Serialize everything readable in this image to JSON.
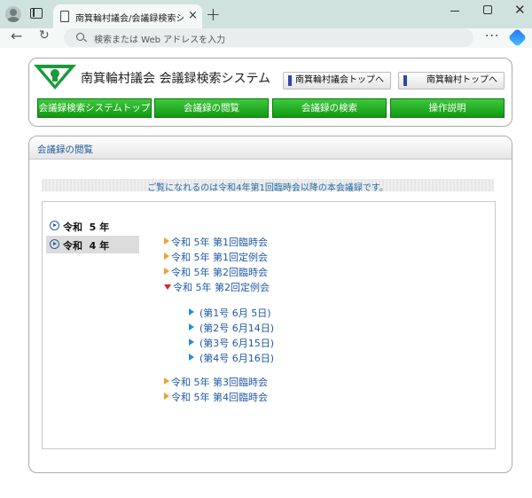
{
  "browser": {
    "tab_title": "南箕輪村議会/会議録検索システム",
    "tab_close": "×",
    "new_tab": "+",
    "url_placeholder": "検索または Web アドレスを入力",
    "back": "←",
    "refresh": "↻",
    "more": "···",
    "close": "✕"
  },
  "header": {
    "site_title": "南箕輪村議会 会議録検索システム",
    "links": [
      "南箕輪村議会トップへ",
      "南箕輪村トップへ"
    ],
    "nav": [
      "会議録検索システムトップ",
      "会議録の閲覧",
      "会議録の検索",
      "操作説明"
    ]
  },
  "main": {
    "heading": "会議録の閲覧",
    "notice": "ご覧になれるのは令和4年第1回臨時会以降の本会議録です。",
    "years": [
      {
        "label": "令和  5 年",
        "selected": false
      },
      {
        "label": "令和  4 年",
        "selected": true
      }
    ],
    "sessions": [
      {
        "label": "令和 5年 第1回臨時会",
        "expanded": false
      },
      {
        "label": "令和 5年 第1回定例会",
        "expanded": false
      },
      {
        "label": "令和 5年 第2回臨時会",
        "expanded": false
      },
      {
        "label": "令和 5年 第2回定例会",
        "expanded": true
      },
      {
        "label": "令和 5年 第3回臨時会",
        "expanded": false
      },
      {
        "label": "令和 5年 第4回臨時会",
        "expanded": false
      }
    ],
    "subitems": [
      "(第1号 6月 5日)",
      "(第2号 6月14日)",
      "(第3号 6月15日)",
      "(第4号 6月16日)"
    ]
  },
  "colors": {
    "nav_green": "#1aa81a",
    "link_blue": "#1f5aa8",
    "heading_blue": "#1f5d99"
  }
}
